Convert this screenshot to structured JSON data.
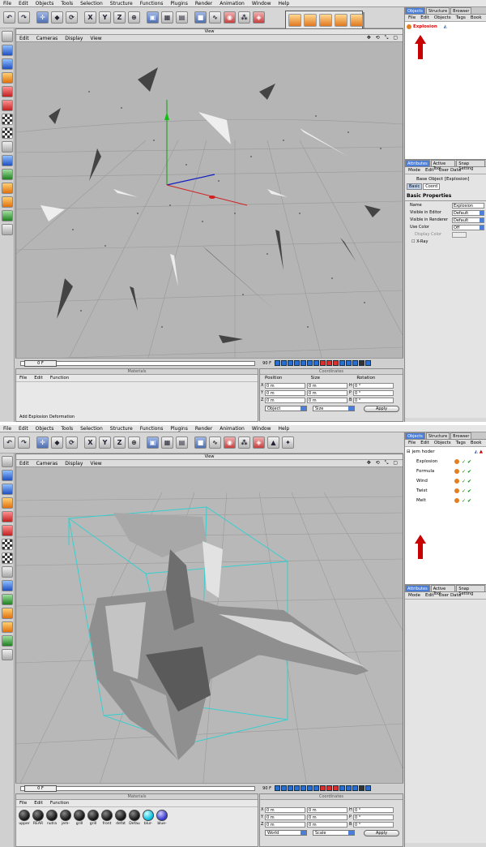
{
  "menu": [
    "File",
    "Edit",
    "Objects",
    "Tools",
    "Selection",
    "Structure",
    "Functions",
    "Plugins",
    "Render",
    "Animation",
    "Window",
    "Help"
  ],
  "viewport": {
    "title": "View",
    "menu": [
      "Edit",
      "Cameras",
      "Display",
      "View"
    ],
    "icons": "✥ ⟲ ⤡ ▢"
  },
  "timeline": {
    "start": "0 F",
    "end": "90 F"
  },
  "materials": {
    "title": "Materials",
    "menu": [
      "File",
      "Edit",
      "Function"
    ],
    "status_text": "Add Explosion Deformation",
    "items": [
      "upper",
      "REAR",
      "nutra",
      "jem-",
      "grill",
      "grill",
      "front",
      "defat",
      "Defau",
      "blur-",
      "blue-"
    ]
  },
  "coordinates": {
    "title": "Coordinates",
    "headers": [
      "Position",
      "Size",
      "Rotation"
    ],
    "top": {
      "rows": [
        {
          "axis": "X",
          "pos": "0 m",
          "size": "0 m",
          "rot_axis": "H",
          "rot": "0 °"
        },
        {
          "axis": "Y",
          "pos": "0 m",
          "size": "0 m",
          "rot_axis": "P",
          "rot": "0 °"
        },
        {
          "axis": "Z",
          "pos": "0 m",
          "size": "0 m",
          "rot_axis": "B",
          "rot": "0 °"
        }
      ],
      "mode": "Object",
      "size_mode": "Size"
    },
    "bottom": {
      "rows": [
        {
          "axis": "X",
          "pos": "0 m",
          "size": "0 m",
          "rot_axis": "H",
          "rot": "0 °"
        },
        {
          "axis": "Y",
          "pos": "0 m",
          "size": "0 m",
          "rot_axis": "P",
          "rot": "0 °"
        },
        {
          "axis": "Z",
          "pos": "0 m",
          "size": "0 m",
          "rot_axis": "B",
          "rot": "0 °"
        }
      ],
      "mode": "World",
      "size_mode": "Scale"
    },
    "apply": "Apply"
  },
  "objects_panel": {
    "tabs": [
      "Objects",
      "Structure",
      "Browser"
    ],
    "menu": [
      "File",
      "Edit",
      "Objects",
      "Tags",
      "Book"
    ],
    "top_item": "Explosion",
    "tree_root": "jem hoder",
    "tree_items": [
      "Explosion",
      "Formula",
      "Wind",
      "Twist",
      "Melt"
    ]
  },
  "attributes": {
    "tabs": [
      "Attributes",
      "Active Tool",
      "Snap Setting"
    ],
    "menu": [
      "Mode",
      "Edit",
      "User Data"
    ],
    "title": "Base Object [Explosion]",
    "buttons": [
      "Basic",
      "Coord"
    ],
    "section": "Basic Properties",
    "rows": [
      {
        "label": "Name",
        "value": "Explosion"
      },
      {
        "label": "Visible in Editor",
        "value": "Default"
      },
      {
        "label": "Visible in Renderer",
        "value": "Default"
      },
      {
        "label": "Use Color",
        "value": "Off"
      },
      {
        "label": "Display Color",
        "value": ""
      }
    ],
    "xray": "X-Ray"
  },
  "colors": {
    "accent": "#4a7ed8",
    "arrow": "#c80000",
    "cage": "#30d0d0"
  }
}
